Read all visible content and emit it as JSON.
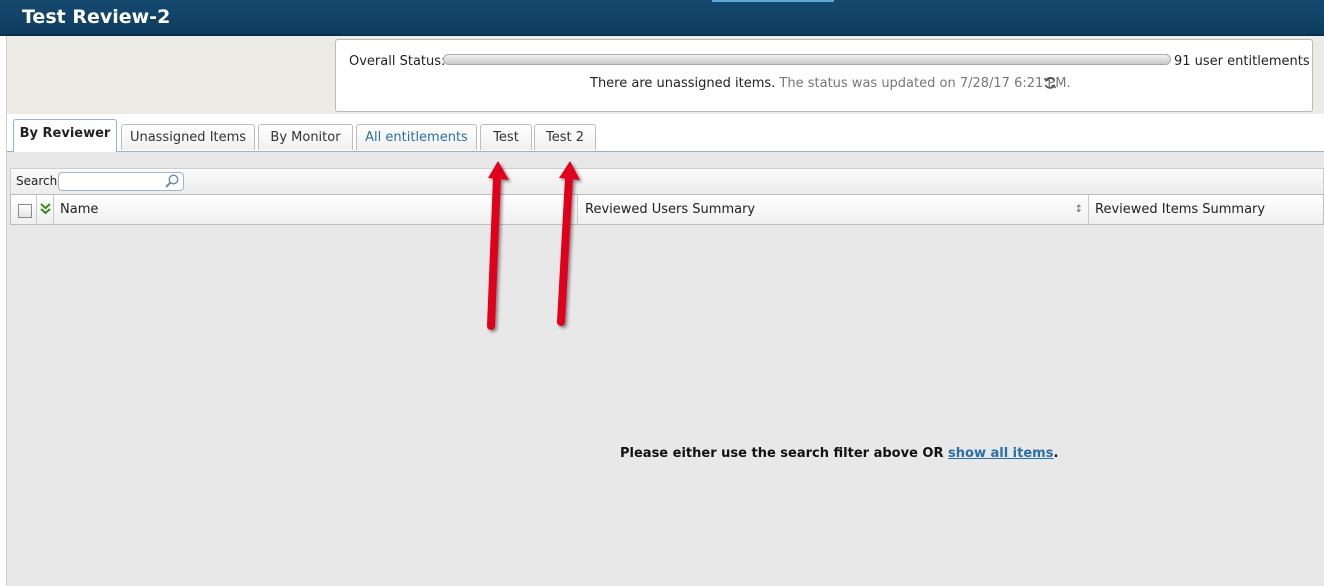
{
  "window": {
    "title": "Test Review-2"
  },
  "status": {
    "label": "Overall Status:",
    "count_text": "91 user entitlements",
    "message": "There are unassigned items.",
    "updated_text": "The status was updated on 7/28/17 6:21 PM.",
    "refresh_icon": "refresh-icon"
  },
  "tabs": [
    {
      "label": "By Reviewer",
      "active": true
    },
    {
      "label": "Unassigned Items",
      "active": false
    },
    {
      "label": "By Monitor",
      "active": false
    },
    {
      "label": "All entitlements",
      "active": false
    },
    {
      "label": "Test",
      "active": false
    },
    {
      "label": "Test 2",
      "active": false
    }
  ],
  "search": {
    "label": "Search:",
    "value": "",
    "placeholder": ""
  },
  "table": {
    "columns": [
      "Name",
      "Reviewed Users Summary",
      "Reviewed Items Summary"
    ]
  },
  "empty_state": {
    "text": "Please either use the search filter above OR",
    "link": "show all items",
    "suffix": "."
  },
  "colors": {
    "titlebar": "#0e3c60",
    "link": "#2a6fa5",
    "annotation_arrow": "#e0001b"
  }
}
